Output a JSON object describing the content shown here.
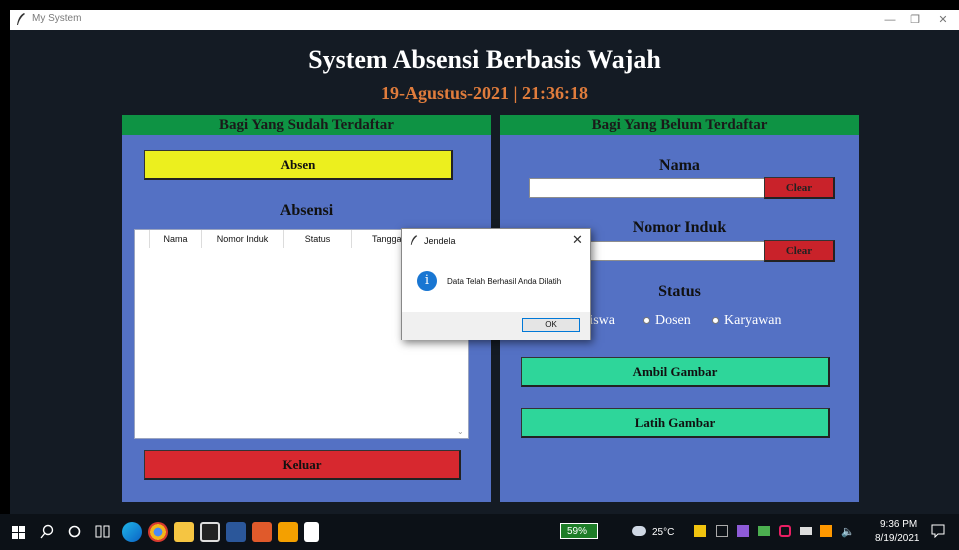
{
  "window": {
    "title": "My System",
    "minimize": "—",
    "restore": "❐",
    "close": "✕"
  },
  "header": {
    "title": "System Absensi Berbasis Wajah",
    "datetime": "19-Agustus-2021  |  21:36:18"
  },
  "left_panel": {
    "header": "Bagi Yang Sudah Terdaftar",
    "absen_button": "Absen",
    "section_title": "Absensi",
    "table_columns": [
      "Nama",
      "Nomor Induk",
      "Status",
      "Tanggal"
    ],
    "keluar_button": "Keluar"
  },
  "right_panel": {
    "header": "Bagi Yang Belum Terdaftar",
    "nama_label": "Nama",
    "nama_value": "",
    "clear_label": "Clear",
    "nomor_label": "Nomor Induk",
    "nomor_value": "",
    "status_label": "Status",
    "radio_options": [
      "Mahasiswa",
      "Dosen",
      "Karyawan"
    ],
    "ambil_button": "Ambil Gambar",
    "latih_button": "Latih Gambar"
  },
  "dialog": {
    "title": "Jendela",
    "close": "✕",
    "message": "Data Telah Berhasil Anda Dilatih",
    "ok_label": "OK",
    "icon": "info-icon"
  },
  "taskbar": {
    "battery": "59%",
    "weather": "25°C",
    "time": "9:36 PM",
    "date": "8/19/2021"
  },
  "colors": {
    "background": "#141b24",
    "panel": "#5471c4",
    "panel_header": "#0e9344",
    "title": "#ffffff",
    "datetime": "#e07c3c",
    "yellow_button": "#ecef1e",
    "red_button": "#d7282f",
    "teal_button": "#2ed69a"
  }
}
